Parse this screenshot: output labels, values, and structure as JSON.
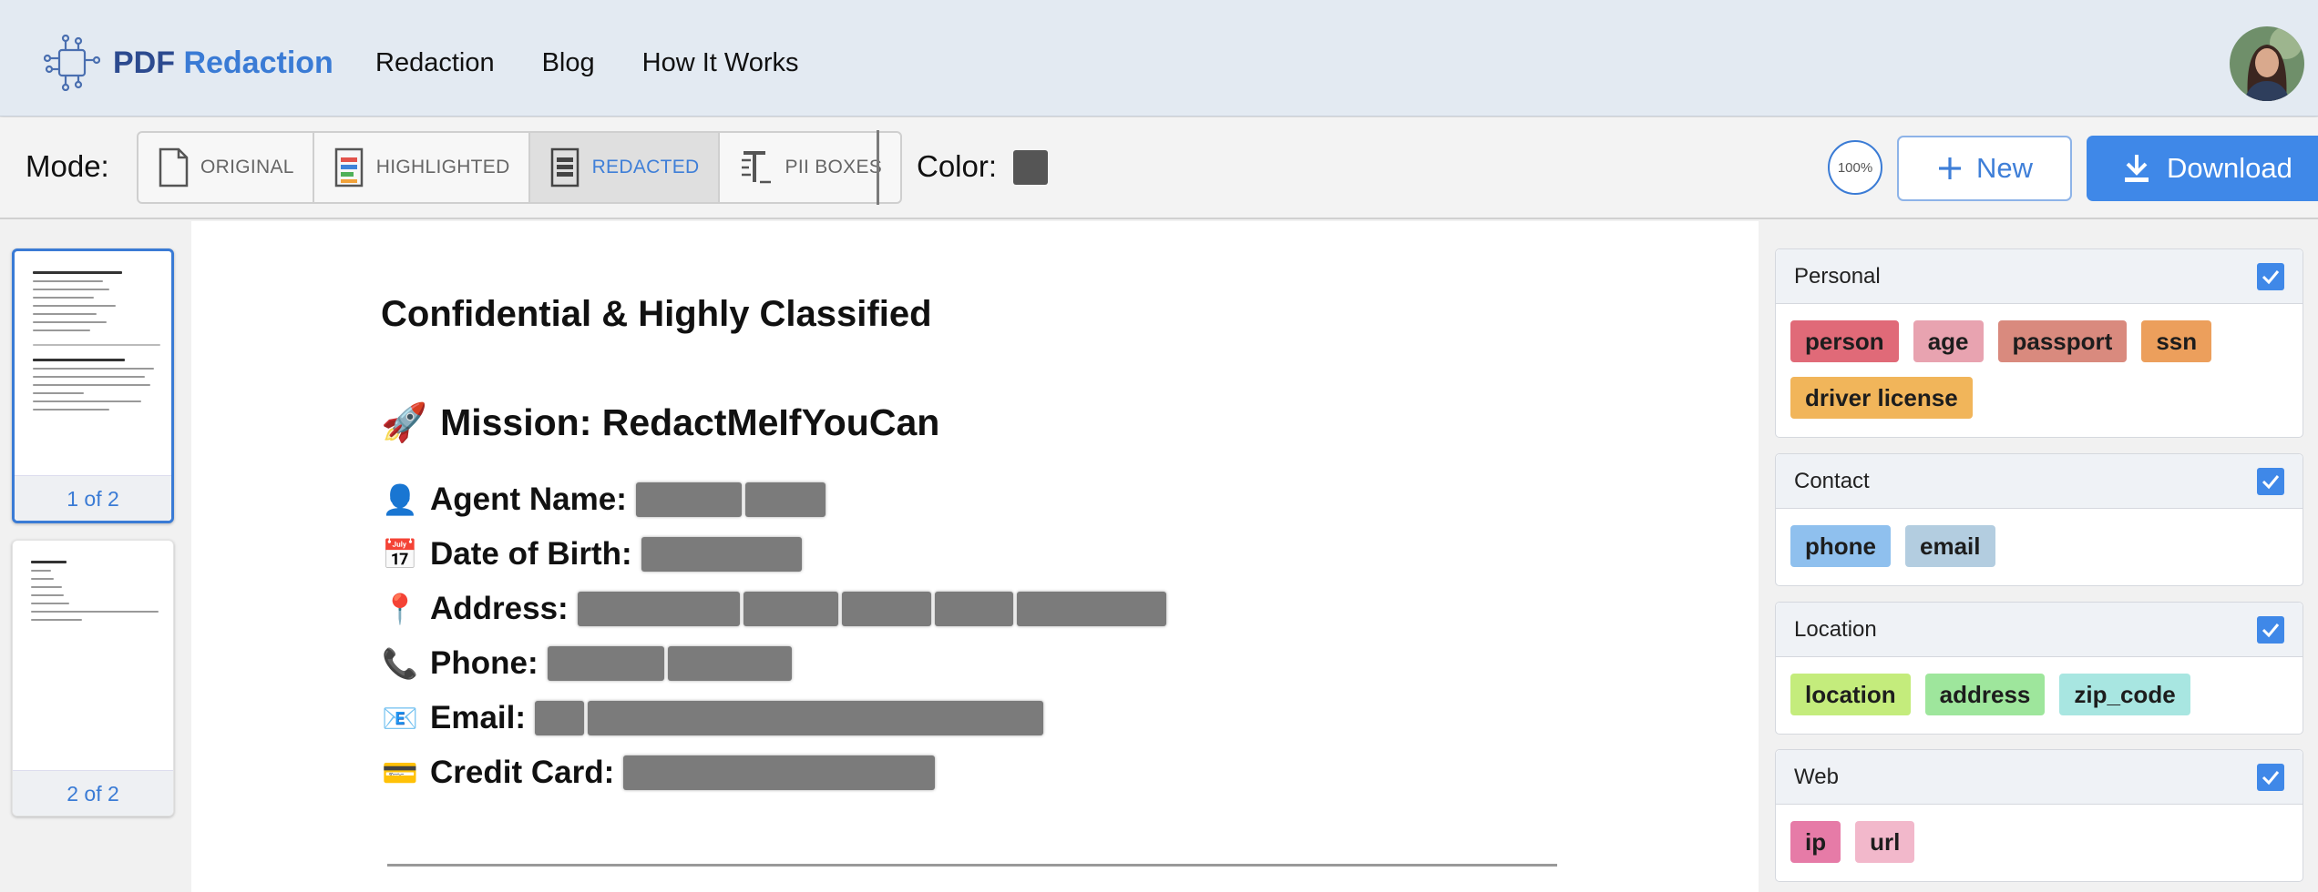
{
  "header": {
    "brand_part1": "PDF",
    "brand_part2": "Redaction",
    "nav": [
      "Redaction",
      "Blog",
      "How It Works"
    ]
  },
  "toolbar": {
    "mode_label": "Mode:",
    "modes": [
      {
        "label": "ORIGINAL",
        "icon": "document-icon",
        "active": false
      },
      {
        "label": "HIGHLIGHTED",
        "icon": "highlighted-document-icon",
        "active": false
      },
      {
        "label": "REDACTED",
        "icon": "redacted-document-icon",
        "active": true
      },
      {
        "label": "PII BOXES",
        "icon": "text-box-icon",
        "active": false
      }
    ],
    "color_label": "Color:",
    "redaction_color": "#555555",
    "zoom": "100%",
    "new_label": "New",
    "download_label": "Download"
  },
  "pages": [
    {
      "label": "1 of 2",
      "selected": true
    },
    {
      "label": "2 of 2",
      "selected": false
    }
  ],
  "document": {
    "title": "Confidential & Highly Classified",
    "mission_emoji": "🚀",
    "mission": "Mission: RedactMeIfYouCan",
    "fields": [
      {
        "emoji": "👤",
        "label": "Agent Name:"
      },
      {
        "emoji": "📅",
        "label": "Date of Birth:"
      },
      {
        "emoji": "📍",
        "label": "Address:"
      },
      {
        "emoji": "📞",
        "label": "Phone:"
      },
      {
        "emoji": "📧",
        "label": "Email:"
      },
      {
        "emoji": "💳",
        "label": "Credit Card:"
      }
    ]
  },
  "categories": [
    {
      "name": "Personal",
      "checked": true,
      "chips": [
        {
          "label": "person",
          "color": "#e06a78"
        },
        {
          "label": "age",
          "color": "#e8a3b0"
        },
        {
          "label": "passport",
          "color": "#d98a7e"
        },
        {
          "label": "ssn",
          "color": "#ec9f5c"
        },
        {
          "label": "driver license",
          "color": "#f1b55a"
        }
      ]
    },
    {
      "name": "Contact",
      "checked": true,
      "chips": [
        {
          "label": "phone",
          "color": "#8fc0ee"
        },
        {
          "label": "email",
          "color": "#b3cde0"
        }
      ]
    },
    {
      "name": "Location",
      "checked": true,
      "chips": [
        {
          "label": "location",
          "color": "#c4ec7c"
        },
        {
          "label": "address",
          "color": "#9ee69c"
        },
        {
          "label": "zip_code",
          "color": "#a8e6e1"
        }
      ]
    },
    {
      "name": "Web",
      "checked": true,
      "chips": [
        {
          "label": "ip",
          "color": "#e67ba7"
        },
        {
          "label": "url",
          "color": "#f2b8cb"
        }
      ]
    }
  ]
}
